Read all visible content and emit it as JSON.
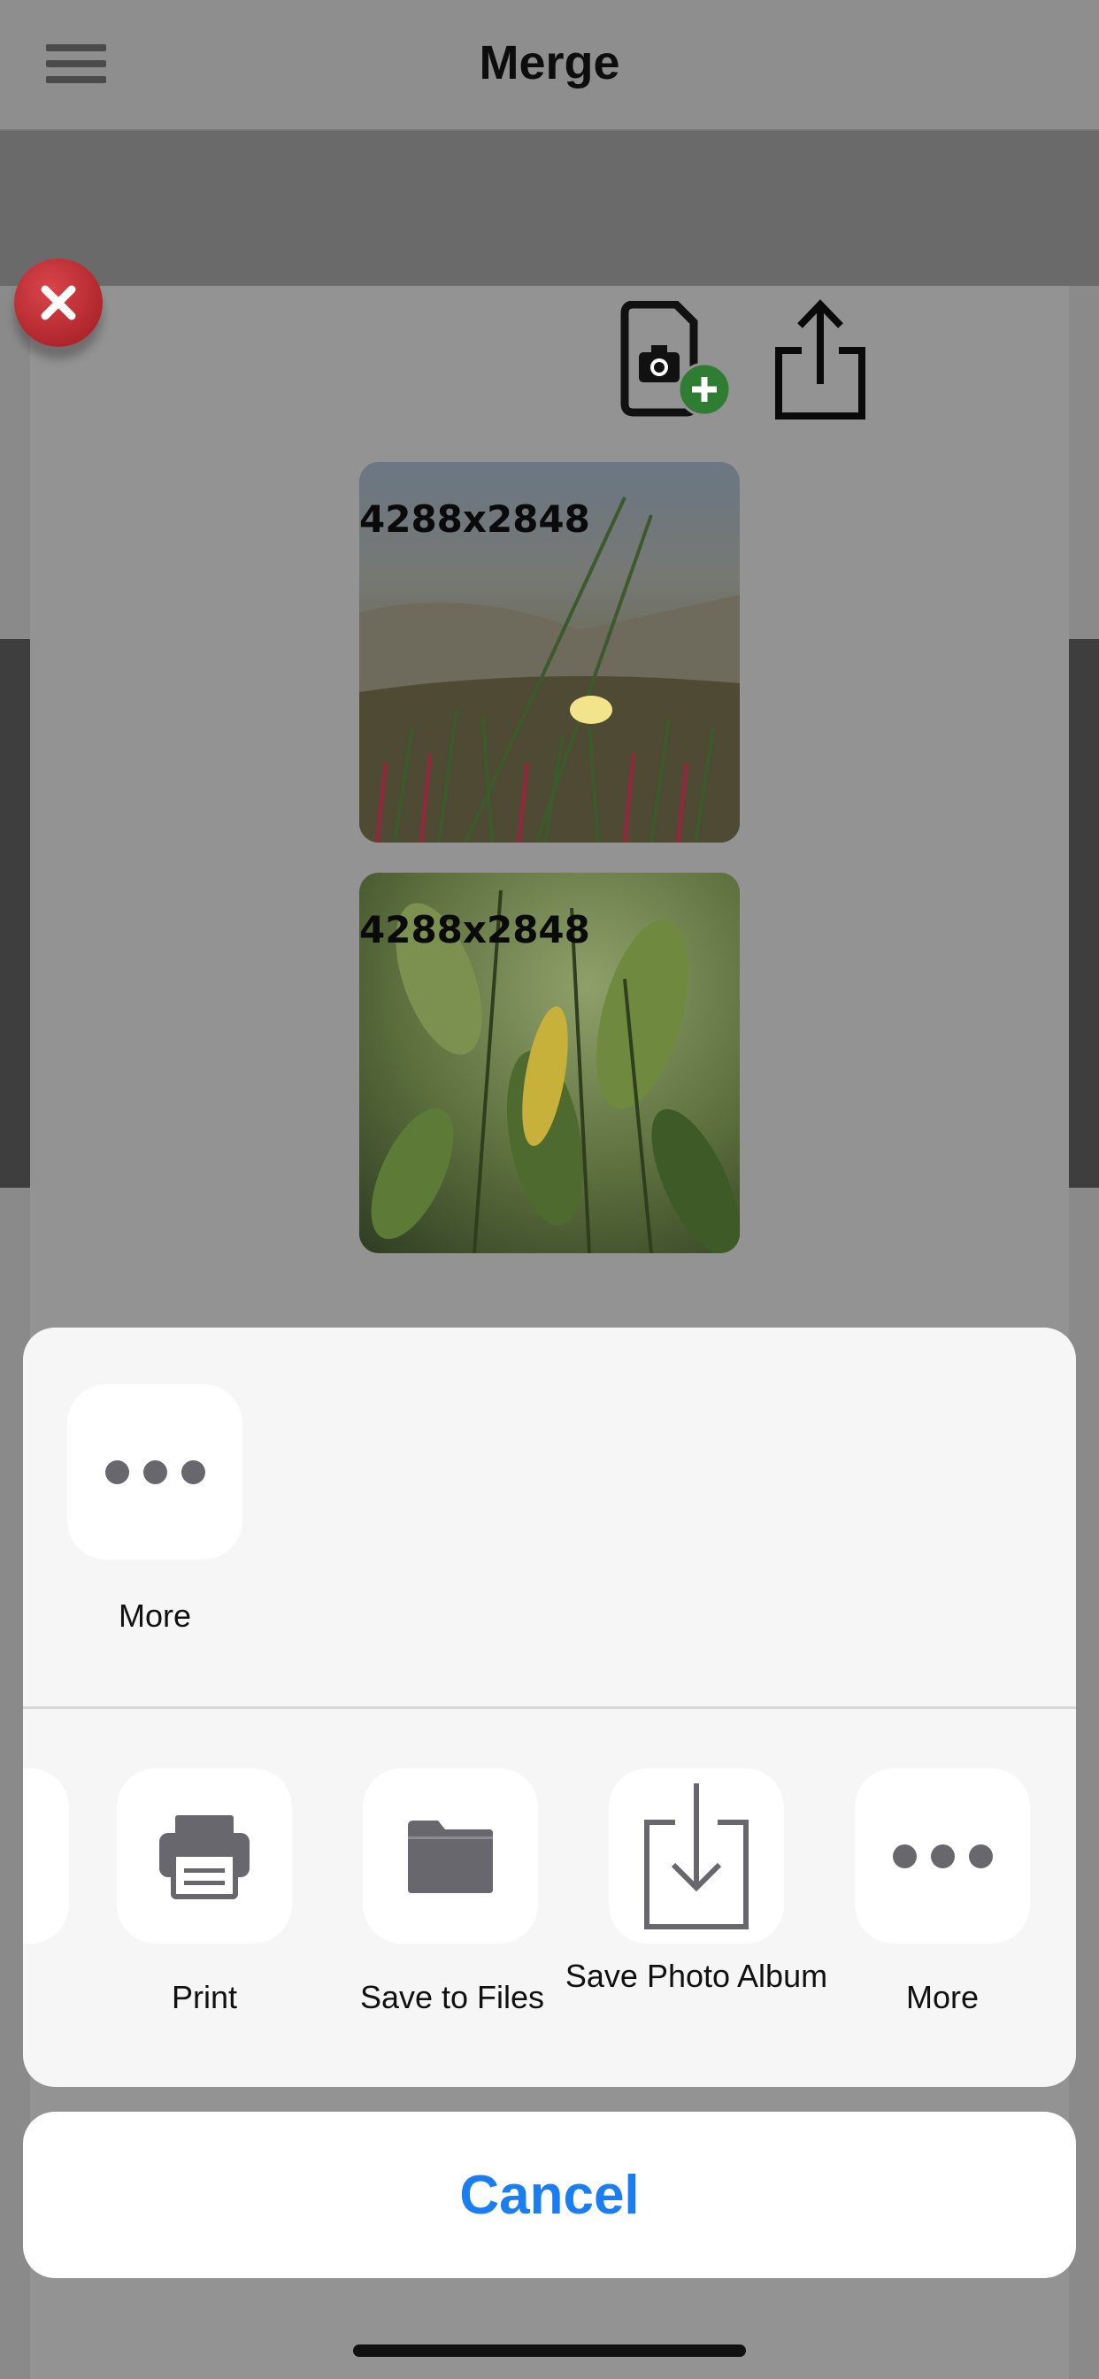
{
  "header": {
    "title": "Merge",
    "menu_icon": "hamburger-menu-icon"
  },
  "toolbar": {
    "close_icon": "close-icon",
    "add_photo_icon": "add-photo-icon",
    "share_icon": "share-icon"
  },
  "images": [
    {
      "label": "4288x2848"
    },
    {
      "label": "4288x2848"
    }
  ],
  "share_sheet": {
    "top_row": [
      {
        "label": "More",
        "icon": "more-icon"
      }
    ],
    "actions": [
      {
        "label": "Print",
        "icon": "print-icon"
      },
      {
        "label": "Save to Files",
        "icon": "folder-icon"
      },
      {
        "label": "Save Photo Album",
        "icon": "save-download-icon"
      },
      {
        "label": "More",
        "icon": "more-icon"
      }
    ],
    "cancel_label": "Cancel"
  },
  "colors": {
    "accent": "#1a7ef2",
    "close_red": "#c8333a",
    "add_green": "#2e7d32"
  }
}
